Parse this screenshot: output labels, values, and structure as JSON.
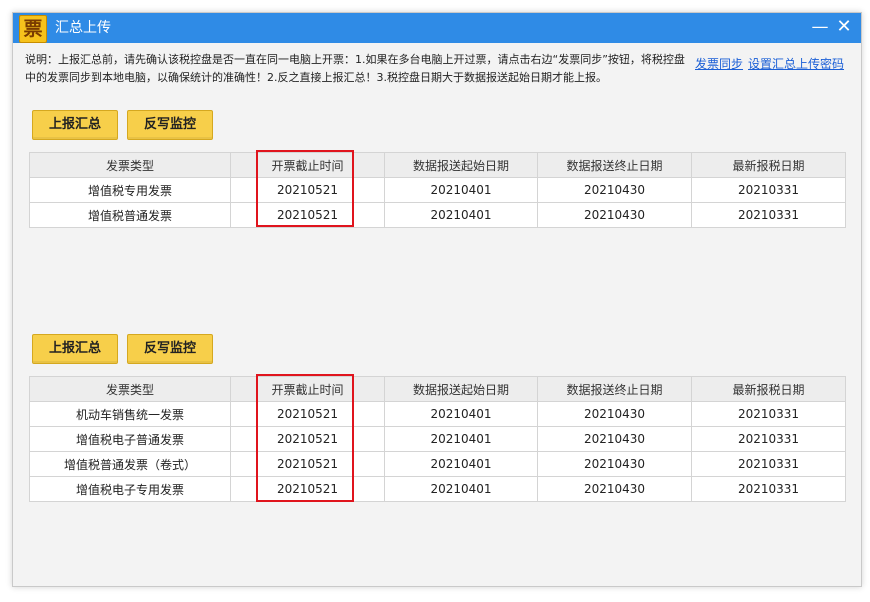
{
  "window": {
    "logo_glyph": "票",
    "title": "汇总上传",
    "minimize_glyph": "—",
    "close_glyph": "✕"
  },
  "description": "说明：上报汇总前，请先确认该税控盘是否一直在同一电脑上开票：1.如果在多台电脑上开过票，请点击右边“发票同步”按钮，将税控盘中的发票同步到本地电脑，以确保统计的准确性！2.反之直接上报汇总！3.税控盘日期大于数据报送起始日期才能上报。",
  "links": {
    "sync": "发票同步",
    "set_password": "设置汇总上传密码"
  },
  "buttons": {
    "upload_summary": "上报汇总",
    "writeback_monitor": "反写监控"
  },
  "columns": [
    "发票类型",
    "开票截止时间",
    "数据报送起始日期",
    "数据报送终止日期",
    "最新报税日期"
  ],
  "table1": [
    {
      "type": "增值税专用发票",
      "deadline": "20210521",
      "start": "20210401",
      "end": "20210430",
      "latest": "20210331"
    },
    {
      "type": "增值税普通发票",
      "deadline": "20210521",
      "start": "20210401",
      "end": "20210430",
      "latest": "20210331"
    }
  ],
  "table2": [
    {
      "type": "机动车销售统一发票",
      "deadline": "20210521",
      "start": "20210401",
      "end": "20210430",
      "latest": "20210331"
    },
    {
      "type": "增值税电子普通发票",
      "deadline": "20210521",
      "start": "20210401",
      "end": "20210430",
      "latest": "20210331"
    },
    {
      "type": "增值税普通发票（卷式）",
      "deadline": "20210521",
      "start": "20210401",
      "end": "20210430",
      "latest": "20210331"
    },
    {
      "type": "增值税电子专用发票",
      "deadline": "20210521",
      "start": "20210401",
      "end": "20210430",
      "latest": "20210331"
    }
  ],
  "colors": {
    "titlebar": "#2f8be6",
    "button": "#f7cf4a",
    "highlight": "#e0141d",
    "link": "#1b5fd6"
  }
}
